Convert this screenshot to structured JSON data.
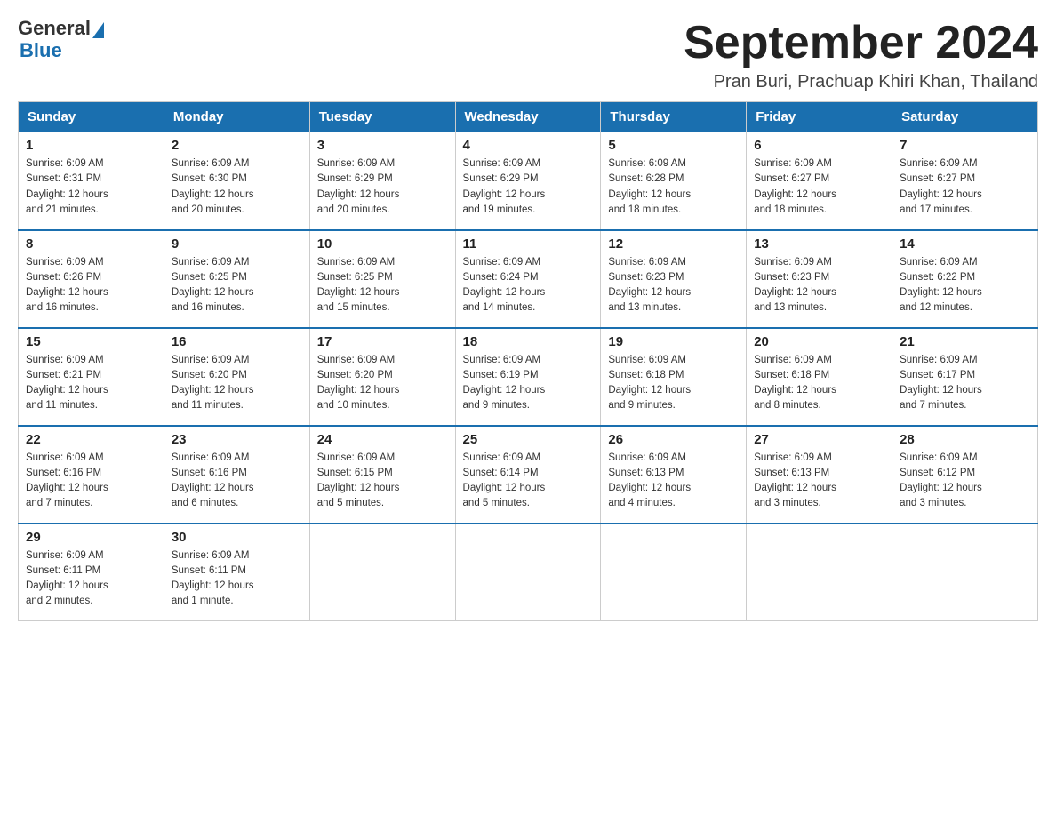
{
  "header": {
    "logo_line1": "General",
    "logo_line2": "Blue",
    "month_title": "September 2024",
    "location": "Pran Buri, Prachuap Khiri Khan, Thailand"
  },
  "weekdays": [
    "Sunday",
    "Monday",
    "Tuesday",
    "Wednesday",
    "Thursday",
    "Friday",
    "Saturday"
  ],
  "weeks": [
    [
      {
        "day": "1",
        "sunrise": "6:09 AM",
        "sunset": "6:31 PM",
        "daylight": "12 hours and 21 minutes."
      },
      {
        "day": "2",
        "sunrise": "6:09 AM",
        "sunset": "6:30 PM",
        "daylight": "12 hours and 20 minutes."
      },
      {
        "day": "3",
        "sunrise": "6:09 AM",
        "sunset": "6:29 PM",
        "daylight": "12 hours and 20 minutes."
      },
      {
        "day": "4",
        "sunrise": "6:09 AM",
        "sunset": "6:29 PM",
        "daylight": "12 hours and 19 minutes."
      },
      {
        "day": "5",
        "sunrise": "6:09 AM",
        "sunset": "6:28 PM",
        "daylight": "12 hours and 18 minutes."
      },
      {
        "day": "6",
        "sunrise": "6:09 AM",
        "sunset": "6:27 PM",
        "daylight": "12 hours and 18 minutes."
      },
      {
        "day": "7",
        "sunrise": "6:09 AM",
        "sunset": "6:27 PM",
        "daylight": "12 hours and 17 minutes."
      }
    ],
    [
      {
        "day": "8",
        "sunrise": "6:09 AM",
        "sunset": "6:26 PM",
        "daylight": "12 hours and 16 minutes."
      },
      {
        "day": "9",
        "sunrise": "6:09 AM",
        "sunset": "6:25 PM",
        "daylight": "12 hours and 16 minutes."
      },
      {
        "day": "10",
        "sunrise": "6:09 AM",
        "sunset": "6:25 PM",
        "daylight": "12 hours and 15 minutes."
      },
      {
        "day": "11",
        "sunrise": "6:09 AM",
        "sunset": "6:24 PM",
        "daylight": "12 hours and 14 minutes."
      },
      {
        "day": "12",
        "sunrise": "6:09 AM",
        "sunset": "6:23 PM",
        "daylight": "12 hours and 13 minutes."
      },
      {
        "day": "13",
        "sunrise": "6:09 AM",
        "sunset": "6:23 PM",
        "daylight": "12 hours and 13 minutes."
      },
      {
        "day": "14",
        "sunrise": "6:09 AM",
        "sunset": "6:22 PM",
        "daylight": "12 hours and 12 minutes."
      }
    ],
    [
      {
        "day": "15",
        "sunrise": "6:09 AM",
        "sunset": "6:21 PM",
        "daylight": "12 hours and 11 minutes."
      },
      {
        "day": "16",
        "sunrise": "6:09 AM",
        "sunset": "6:20 PM",
        "daylight": "12 hours and 11 minutes."
      },
      {
        "day": "17",
        "sunrise": "6:09 AM",
        "sunset": "6:20 PM",
        "daylight": "12 hours and 10 minutes."
      },
      {
        "day": "18",
        "sunrise": "6:09 AM",
        "sunset": "6:19 PM",
        "daylight": "12 hours and 9 minutes."
      },
      {
        "day": "19",
        "sunrise": "6:09 AM",
        "sunset": "6:18 PM",
        "daylight": "12 hours and 9 minutes."
      },
      {
        "day": "20",
        "sunrise": "6:09 AM",
        "sunset": "6:18 PM",
        "daylight": "12 hours and 8 minutes."
      },
      {
        "day": "21",
        "sunrise": "6:09 AM",
        "sunset": "6:17 PM",
        "daylight": "12 hours and 7 minutes."
      }
    ],
    [
      {
        "day": "22",
        "sunrise": "6:09 AM",
        "sunset": "6:16 PM",
        "daylight": "12 hours and 7 minutes."
      },
      {
        "day": "23",
        "sunrise": "6:09 AM",
        "sunset": "6:16 PM",
        "daylight": "12 hours and 6 minutes."
      },
      {
        "day": "24",
        "sunrise": "6:09 AM",
        "sunset": "6:15 PM",
        "daylight": "12 hours and 5 minutes."
      },
      {
        "day": "25",
        "sunrise": "6:09 AM",
        "sunset": "6:14 PM",
        "daylight": "12 hours and 5 minutes."
      },
      {
        "day": "26",
        "sunrise": "6:09 AM",
        "sunset": "6:13 PM",
        "daylight": "12 hours and 4 minutes."
      },
      {
        "day": "27",
        "sunrise": "6:09 AM",
        "sunset": "6:13 PM",
        "daylight": "12 hours and 3 minutes."
      },
      {
        "day": "28",
        "sunrise": "6:09 AM",
        "sunset": "6:12 PM",
        "daylight": "12 hours and 3 minutes."
      }
    ],
    [
      {
        "day": "29",
        "sunrise": "6:09 AM",
        "sunset": "6:11 PM",
        "daylight": "12 hours and 2 minutes."
      },
      {
        "day": "30",
        "sunrise": "6:09 AM",
        "sunset": "6:11 PM",
        "daylight": "12 hours and 1 minute."
      },
      null,
      null,
      null,
      null,
      null
    ]
  ],
  "labels": {
    "sunrise": "Sunrise:",
    "sunset": "Sunset:",
    "daylight": "Daylight:"
  }
}
